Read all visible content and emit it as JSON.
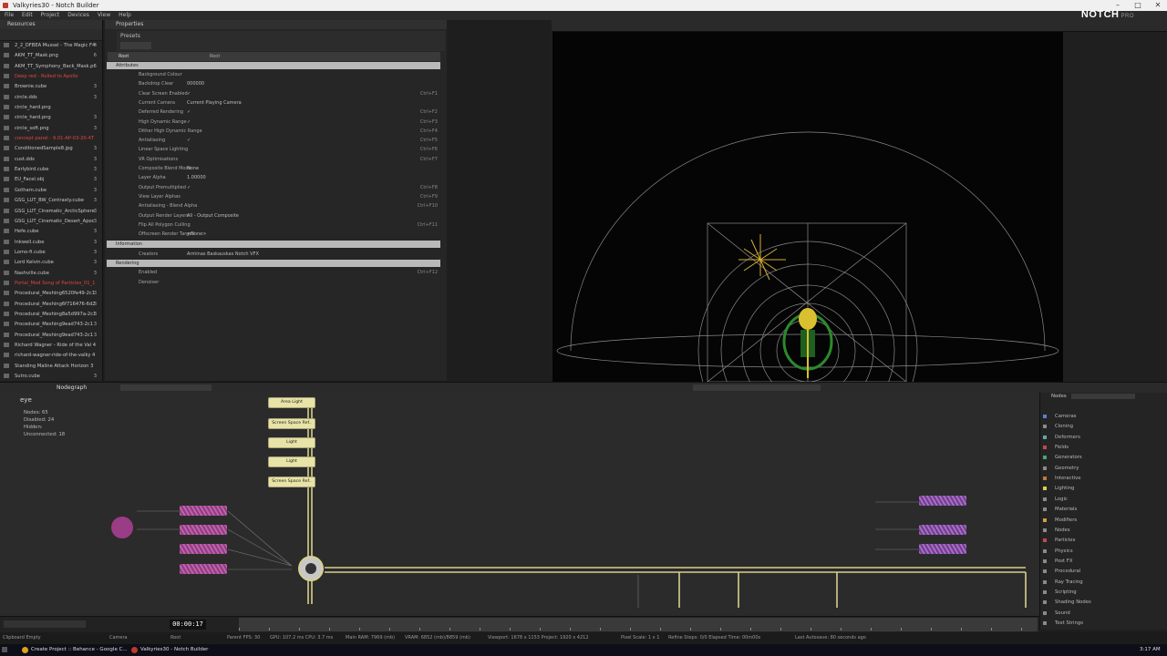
{
  "window": {
    "title": "Valkyries30 - Notch Builder",
    "minimize": "–",
    "maximize": "□",
    "close": "✕"
  },
  "menu": [
    "File",
    "Edit",
    "Project",
    "Devices",
    "View",
    "Help"
  ],
  "brand": {
    "name": "NOTCH",
    "tier": "PRO"
  },
  "resources": {
    "title": "Resources",
    "items": [
      {
        "name": "2_2_DFBEA Mussel - The Magic F4",
        "count": "4",
        "red": false
      },
      {
        "name": "AKM_TT_Mask.png",
        "count": "6",
        "red": false
      },
      {
        "name": "AKM_TT_Symphony_Back_Mask.p6",
        "count": "",
        "red": false
      },
      {
        "name": "Deep red - Rolled to Apollo",
        "count": "",
        "red": true
      },
      {
        "name": "Brownie.cube",
        "count": "3",
        "red": false
      },
      {
        "name": "circle.dds",
        "count": "3",
        "red": false
      },
      {
        "name": "circle_hard.png",
        "count": "",
        "red": false
      },
      {
        "name": "circle_hard.png",
        "count": "3",
        "red": false
      },
      {
        "name": "circle_soft.png",
        "count": "3",
        "red": false
      },
      {
        "name": "concept panel - 9.01-AP-03-20-4T",
        "count": "",
        "red": true
      },
      {
        "name": "ConditionedSample8.jpg",
        "count": "3",
        "red": false
      },
      {
        "name": "cust.dds",
        "count": "3",
        "red": false
      },
      {
        "name": "Earlybird.cube",
        "count": "3",
        "red": false
      },
      {
        "name": "EU_Facel.obj",
        "count": "3",
        "red": false
      },
      {
        "name": "Gotham.cube",
        "count": "3",
        "red": false
      },
      {
        "name": "GSG_LUT_BW_Contrasty.cube",
        "count": "3",
        "red": false
      },
      {
        "name": "GSG_LUT_Cinematic_ArcticSphere",
        "count": "3",
        "red": false
      },
      {
        "name": "GSG_LUT_Cinematic_Desert_Apoc",
        "count": "3",
        "red": false
      },
      {
        "name": "Hefe.cube",
        "count": "3",
        "red": false
      },
      {
        "name": "Inkwell.cube",
        "count": "3",
        "red": false
      },
      {
        "name": "Lomo-fi.cube",
        "count": "3",
        "red": false
      },
      {
        "name": "Lord Kelvin.cube",
        "count": "3",
        "red": false
      },
      {
        "name": "Nashville.cube",
        "count": "3",
        "red": false
      },
      {
        "name": "Portal_Mod Song of Particles_01_1",
        "count": "",
        "red": true
      },
      {
        "name": "Procedural_Meshing6520fe49-2c1",
        "count": "3",
        "red": false
      },
      {
        "name": "Procedural_Meshing6f716476-6d2",
        "count": "3",
        "red": false
      },
      {
        "name": "Procedural_Meshing8a5d997a-2c1",
        "count": "3",
        "red": false
      },
      {
        "name": "Procedural_Meshing9ead743-2c1",
        "count": "3",
        "red": false
      },
      {
        "name": "Procedural_Meshing9ead743-2c1",
        "count": "3",
        "red": false
      },
      {
        "name": "Richard Wagner - Ride of the Val 4",
        "count": "",
        "red": false
      },
      {
        "name": "richard-wagner-ride-of-the-valky 4",
        "count": "",
        "red": false
      },
      {
        "name": "Standing Maline Attack Horizon 3",
        "count": "",
        "red": false
      },
      {
        "name": "Sutro.cube",
        "count": "3",
        "red": false
      }
    ]
  },
  "properties": {
    "title": "Properties",
    "presets": "Presets",
    "root_label": "Root",
    "root_value": "Root",
    "sections": {
      "attributes": "Attributes",
      "information": "Information",
      "rendering": "Rendering"
    },
    "attribute_rows": [
      {
        "label": "Background Colour",
        "value": "",
        "shortcut": ""
      },
      {
        "label": "Backdrop Clear",
        "value": "000000",
        "shortcut": ""
      },
      {
        "label": "Clear Screen Enabled",
        "value": "✓",
        "shortcut": "Ctrl+F1"
      },
      {
        "label": "Current Camera",
        "value": "Current Playing Camera",
        "shortcut": ""
      },
      {
        "label": "Deferred Rendering",
        "value": "✓",
        "shortcut": "Ctrl+F2"
      },
      {
        "label": "High Dynamic Range",
        "value": "✓",
        "shortcut": "Ctrl+F3"
      },
      {
        "label": "Dither High Dynamic Range",
        "value": "",
        "shortcut": "Ctrl+F4"
      },
      {
        "label": "Antialiasing",
        "value": "✓",
        "shortcut": "Ctrl+F5"
      },
      {
        "label": "Linear Space Lighting",
        "value": "",
        "shortcut": "Ctrl+F6"
      },
      {
        "label": "VR Optimisations",
        "value": "",
        "shortcut": "Ctrl+F7"
      },
      {
        "label": "Composite Blend Mode",
        "value": "None",
        "shortcut": ""
      },
      {
        "label": "Layer Alpha",
        "value": "1.00000",
        "shortcut": ""
      },
      {
        "label": "Output Premultiplied",
        "value": "✓",
        "shortcut": "Ctrl+F8"
      },
      {
        "label": "View Layer Alphas",
        "value": "",
        "shortcut": "Ctrl+F9"
      },
      {
        "label": "Antialiasing - Blend Alpha",
        "value": "",
        "shortcut": "Ctrl+F10"
      },
      {
        "label": "Output Render Layers",
        "value": "All - Output Composite",
        "shortcut": ""
      },
      {
        "label": "Flip All Polygon Culling",
        "value": "",
        "shortcut": "Ctrl+F11"
      },
      {
        "label": "Offscreen Render Target",
        "value": "<None>",
        "shortcut": ""
      }
    ],
    "creators_label": "Creators",
    "creators_value": "Arminas Baskauskas Notch VFX",
    "rendering_rows": [
      {
        "label": "Enabled",
        "value": "",
        "shortcut": "Ctrl+F12"
      },
      {
        "label": "Denoiser",
        "value": "",
        "shortcut": ""
      }
    ]
  },
  "nodegraph": {
    "tab": "Nodegraph",
    "info": {
      "name": "eye",
      "nodes": "Nodes:  65",
      "disabled": "Disabled:  24",
      "hidden": "Hidden:",
      "unconnected": "Unconnected:  18"
    },
    "nodes": [
      "Area Light",
      "Screen Space Ref..",
      "Light",
      "Light",
      "Screen Space Ref.."
    ]
  },
  "nodes_panel": {
    "title": "Nodes",
    "categories": [
      {
        "name": "Cameras",
        "color": "#5a7fd0"
      },
      {
        "name": "Cloning",
        "color": "#8a8a8a"
      },
      {
        "name": "Deformers",
        "color": "#5fa8a8"
      },
      {
        "name": "Fields",
        "color": "#c04a4a"
      },
      {
        "name": "Generators",
        "color": "#4aa86a"
      },
      {
        "name": "Geometry",
        "color": "#8a8a8a"
      },
      {
        "name": "Interactive",
        "color": "#c07a3a"
      },
      {
        "name": "Lighting",
        "color": "#d8d050"
      },
      {
        "name": "Logic",
        "color": "#8a8a8a"
      },
      {
        "name": "Materials",
        "color": "#8a8a8a"
      },
      {
        "name": "Modifiers",
        "color": "#d0a040"
      },
      {
        "name": "Nodes",
        "color": "#8a8a8a"
      },
      {
        "name": "Particles",
        "color": "#c04a4a"
      },
      {
        "name": "Physics",
        "color": "#8a8a8a"
      },
      {
        "name": "Post FX",
        "color": "#8a8a8a"
      },
      {
        "name": "Procedural",
        "color": "#8a8a8a"
      },
      {
        "name": "Ray Tracing",
        "color": "#8a8a8a"
      },
      {
        "name": "Scripting",
        "color": "#8a8a8a"
      },
      {
        "name": "Shading Nodes",
        "color": "#8a8a8a"
      },
      {
        "name": "Sound",
        "color": "#8a8a8a"
      },
      {
        "name": "Text Strings",
        "color": "#8a8a8a"
      }
    ]
  },
  "timeline": {
    "timecode": "00:00:17"
  },
  "status": {
    "clipboard": "Clipboard Empty",
    "camera": "Camera",
    "root": "Root",
    "parent_fps": "Parent FPS: 30",
    "gpu": "GPU: 107.2 ms  CPU: 3.7 ms",
    "ram": "Main RAM: 7969 (mb)",
    "vram": "VRAM: 6852 (mb)/8859 (mb)",
    "viewport": "Viewport: 1678 x 1153  Project: 1920 x 4212",
    "pixel_scale": "Pixel Scale: 1 x 1",
    "refine": "Refine Steps: 0/0  Elapsed Time: 00m00s",
    "autosave": "Last Autosave: 80 seconds ago"
  },
  "taskbar": {
    "tasks": [
      "Create Project :: Behance - Google C...",
      "Valkyries30 - Notch Builder"
    ],
    "clock": "3:17 AM"
  }
}
